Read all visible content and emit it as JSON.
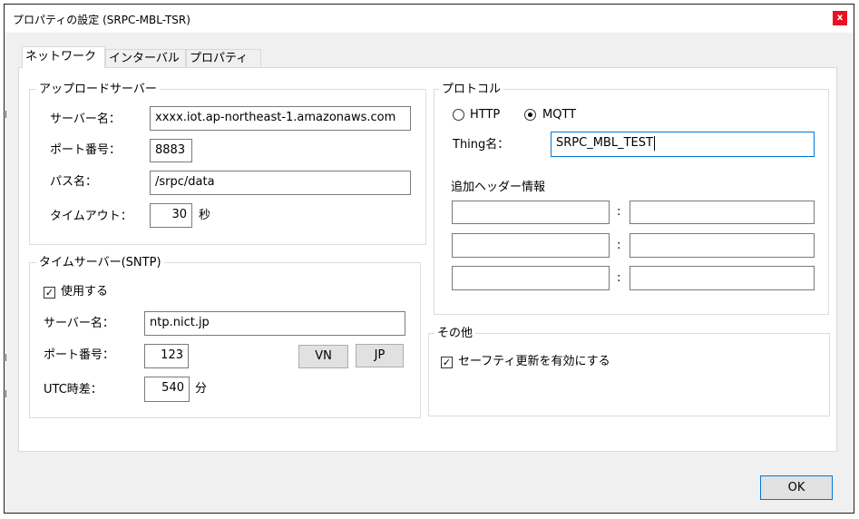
{
  "window": {
    "title": "プロパティの設定 (SRPC-MBL-TSR)",
    "close_glyph": "x"
  },
  "tabs": [
    {
      "label": "ネットワーク",
      "active": true
    },
    {
      "label": "インターバル",
      "active": false
    },
    {
      "label": "プロパティ",
      "active": false
    }
  ],
  "upload_server": {
    "legend": "アップロードサーバー",
    "server_name_label": "サーバー名：",
    "server_name_value": "xxxx.iot.ap-northeast-1.amazonaws.com",
    "port_label": "ポート番号：",
    "port_value": "8883",
    "path_label": "パス名：",
    "path_value": "/srpc/data",
    "timeout_label": "タイムアウト：",
    "timeout_value": "30",
    "timeout_unit": "秒"
  },
  "time_server": {
    "legend": "タイムサーバー(SNTP)",
    "use_label": "使用する",
    "use_checked": true,
    "use_check_glyph": "✓",
    "server_name_label": "サーバー名：",
    "server_name_value": "ntp.nict.jp",
    "port_label": "ポート番号：",
    "port_value": "123",
    "vn_button": "VN",
    "jp_button": "JP",
    "utc_label": "UTC時差：",
    "utc_value": "540",
    "utc_unit": "分"
  },
  "protocol": {
    "legend": "プロトコル",
    "options": [
      {
        "label": "HTTP",
        "selected": false
      },
      {
        "label": "MQTT",
        "selected": true
      }
    ],
    "thing_label": "Thing名：",
    "thing_value": "SRPC_MBL_TEST",
    "headers_label": "追加ヘッダー情報",
    "header_separator": ":",
    "headers": [
      {
        "key": "",
        "value": ""
      },
      {
        "key": "",
        "value": ""
      },
      {
        "key": "",
        "value": ""
      }
    ]
  },
  "other": {
    "legend": "その他",
    "safety_update_label": "セーフティ更新を有効にする",
    "safety_update_checked": true,
    "check_glyph": "✓"
  },
  "footer": {
    "ok_button": "OK"
  }
}
